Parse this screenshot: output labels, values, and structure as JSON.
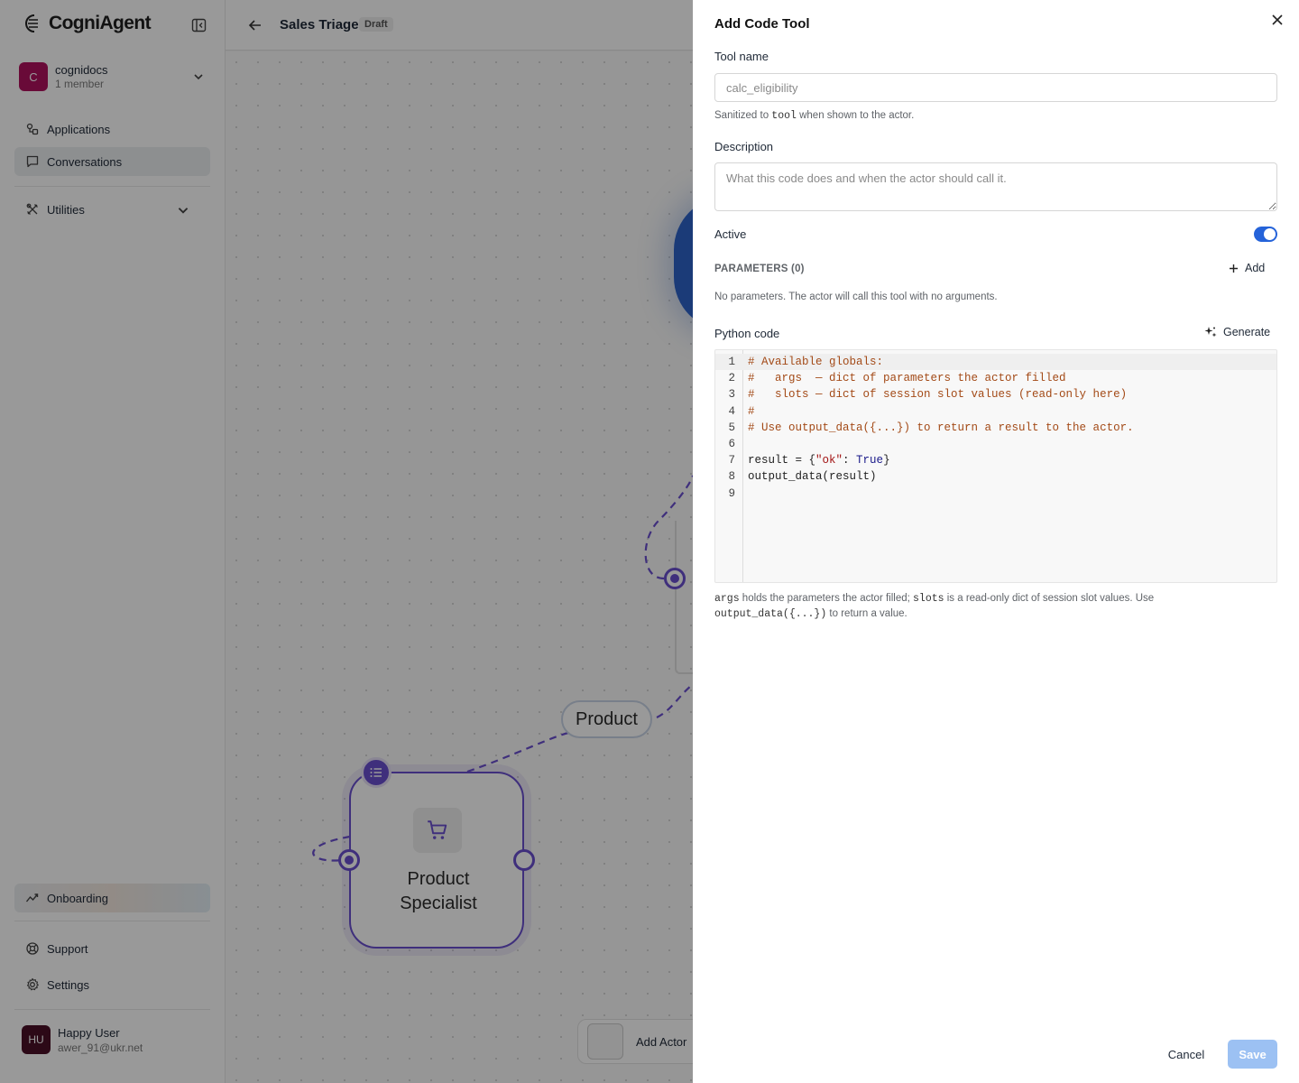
{
  "sidebar": {
    "brand": "CogniAgent",
    "org": {
      "initial": "C",
      "name": "cognidocs",
      "members": "1 member",
      "color": "#b0125e"
    },
    "nav": {
      "applications": "Applications",
      "conversations": "Conversations",
      "utilities": "Utilities",
      "onboarding": "Onboarding",
      "support": "Support",
      "settings": "Settings"
    },
    "active_item": "Conversations",
    "user": {
      "initials": "HU",
      "name": "Happy User",
      "email": "awer_91@ukr.net"
    }
  },
  "canvas": {
    "title": "Sales Triage",
    "status": "Draft",
    "edge_label": "Product",
    "node_title": "Product\nSpecialist",
    "add_actor": "Add Actor",
    "accent_color": "#6a4fcf"
  },
  "drawer": {
    "title": "Add Code Tool",
    "tool_name_label": "Tool name",
    "tool_name_placeholder": "calc_eligibility",
    "sanitize_pre": "Sanitized to ",
    "sanitize_code": "tool",
    "sanitize_post": " when shown to the actor.",
    "description_label": "Description",
    "description_placeholder": "What this code does and when the actor should call it.",
    "active_label": "Active",
    "active": true,
    "parameters_heading": "PARAMETERS (0)",
    "add_label": "Add",
    "no_params_text": "No parameters. The actor will call this tool with no arguments.",
    "python_label": "Python code",
    "generate_label": "Generate",
    "code_lines": [
      "# Available globals:",
      "#   args  — dict of parameters the actor filled",
      "#   slots — dict of session slot values (read-only here)",
      "#",
      "# Use output_data({...}) to return a result to the actor.",
      "",
      "result = {\"ok\": True}",
      "output_data(result)",
      ""
    ],
    "footnote": {
      "code1": "args",
      "text1": " holds the parameters the actor filled; ",
      "code2": "slots",
      "text2": " is a read-only dict of session slot values. Use",
      "code3": "output_data({...})",
      "text3": " to return a value."
    },
    "cancel_label": "Cancel",
    "save_label": "Save",
    "primary_color": "#2563d9"
  }
}
